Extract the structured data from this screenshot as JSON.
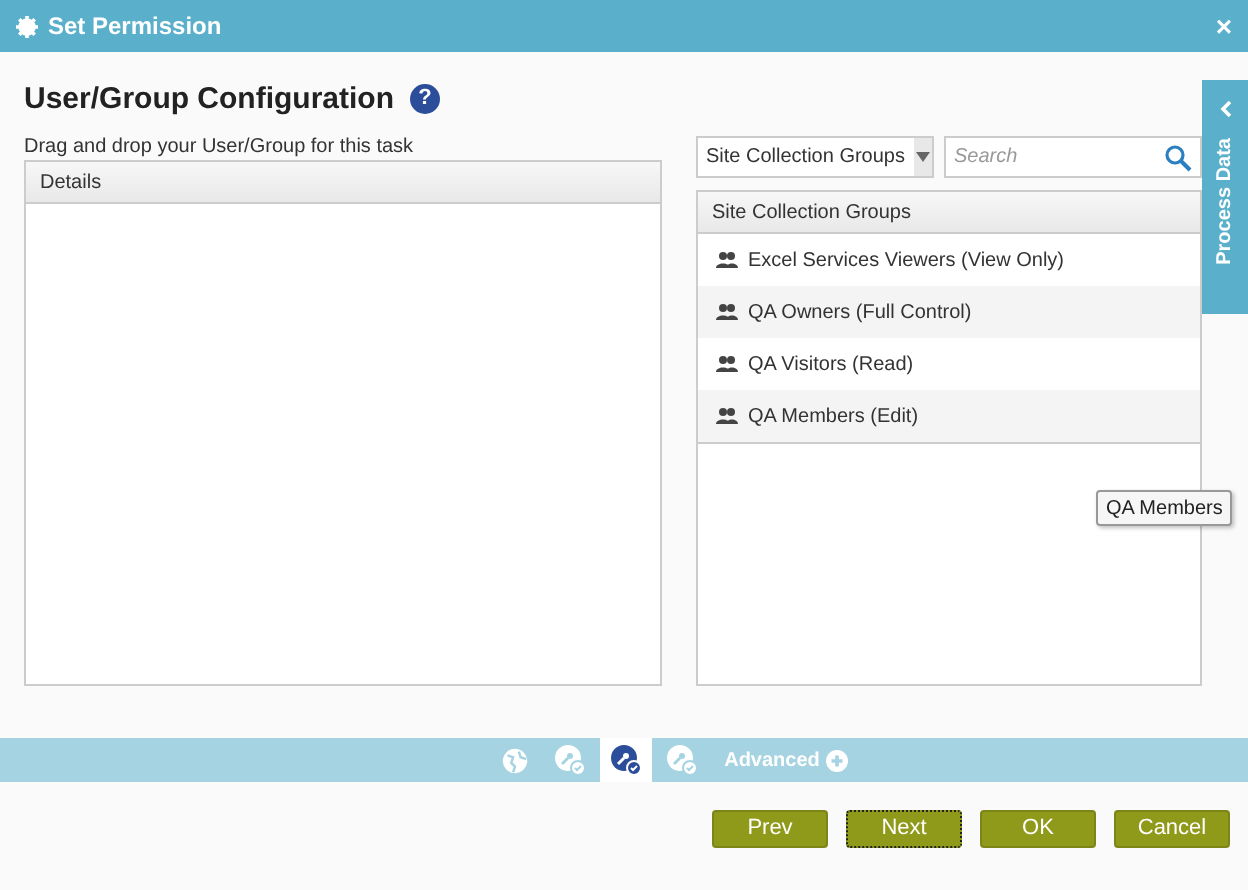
{
  "window": {
    "title": "Set Permission",
    "close": "×"
  },
  "heading": "User/Group Configuration",
  "help": "?",
  "instruction": "Drag and drop your User/Group for this task",
  "details": {
    "header": "Details"
  },
  "source": {
    "dropdown": "Site Collection Groups",
    "search_placeholder": "Search"
  },
  "groups": {
    "header": "Site Collection Groups",
    "items": [
      {
        "label": "Excel Services Viewers (View Only)"
      },
      {
        "label": "QA Owners (Full Control)"
      },
      {
        "label": "QA Visitors (Read)"
      },
      {
        "label": "QA Members (Edit)"
      }
    ]
  },
  "tooltip": "QA Members",
  "side_tab": {
    "label": "Process Data"
  },
  "toolbar": {
    "tools": [
      {
        "kind": "globe",
        "selected": false
      },
      {
        "kind": "key",
        "selected": false
      },
      {
        "kind": "key",
        "selected": true
      },
      {
        "kind": "key",
        "selected": false
      }
    ],
    "advanced": "Advanced"
  },
  "buttons": [
    {
      "label": "Prev",
      "focused": false
    },
    {
      "label": "Next",
      "focused": true
    },
    {
      "label": "OK",
      "focused": false
    },
    {
      "label": "Cancel",
      "focused": false
    }
  ]
}
